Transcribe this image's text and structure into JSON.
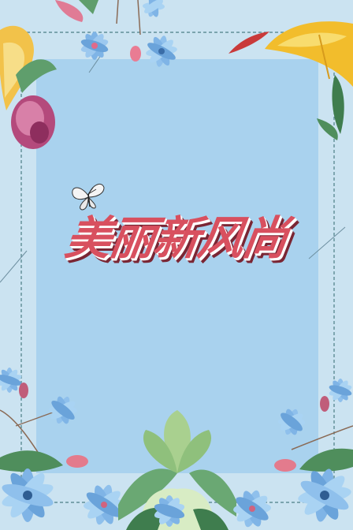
{
  "poster": {
    "title": "美丽新风尚"
  },
  "colors": {
    "background": "#cbe3f1",
    "panel": "#a9d2ee",
    "border_dash": "#4b7f86",
    "title_fill": "#d8505f",
    "title_shadow": "#7a2634"
  },
  "decorations": [
    "flowers-top-left",
    "calla-lily-top-right",
    "butterfly",
    "flowers-bottom-left",
    "flowers-bottom-center",
    "flowers-bottom-right"
  ]
}
